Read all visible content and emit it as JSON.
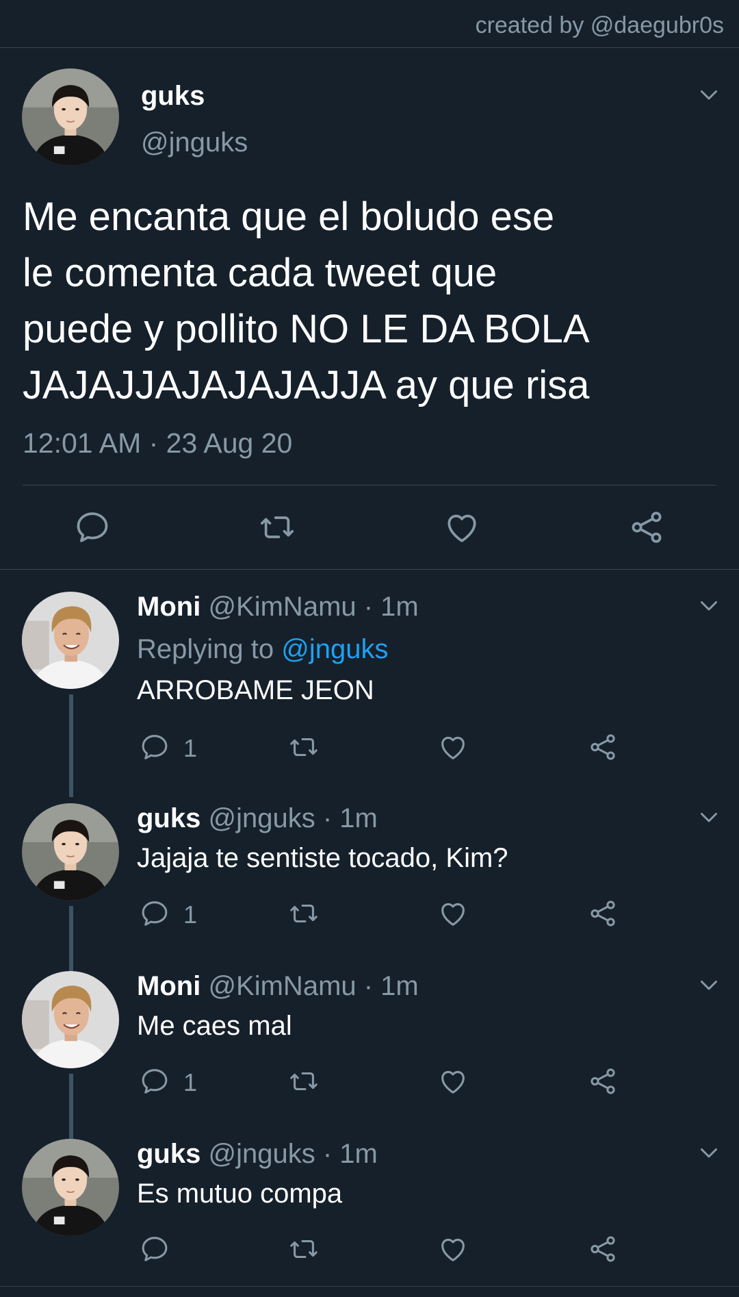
{
  "credit": "created by @daegubr0s",
  "main_tweet": {
    "name": "guks",
    "handle": "@jnguks",
    "text": "Me encanta que el boludo ese\nle comenta cada tweet que\npuede y pollito NO LE DA BOLA\nJAJAJJAJAJAJAJJA ay que risa",
    "timestamp": "12:01 AM · 23 Aug 20",
    "icons": [
      "reply-icon",
      "retweet-icon",
      "like-icon",
      "share-icon"
    ]
  },
  "replies": [
    {
      "name": "Moni",
      "meta": "@KimNamu · 1m",
      "replying_label": "Replying to",
      "replying_handle": "@jnguks",
      "text": "ARROBAME JEON",
      "reply_count": "1",
      "avatar": "moni"
    },
    {
      "name": "guks",
      "meta": "@jnguks · 1m",
      "text": "Jajaja te sentiste tocado, Kim?",
      "reply_count": "1",
      "avatar": "guks"
    },
    {
      "name": "Moni",
      "meta": "@KimNamu · 1m",
      "text": "Me caes mal",
      "reply_count": "1",
      "avatar": "moni"
    },
    {
      "name": "guks",
      "meta": "@jnguks · 1m",
      "text": "Es mutuo compa",
      "reply_count": "",
      "avatar": "guks"
    }
  ],
  "colors": {
    "background": "#15202b",
    "secondary_text": "#8899a6",
    "link": "#1da1f2",
    "divider": "#38444d",
    "thread_line": "#3d5466"
  }
}
